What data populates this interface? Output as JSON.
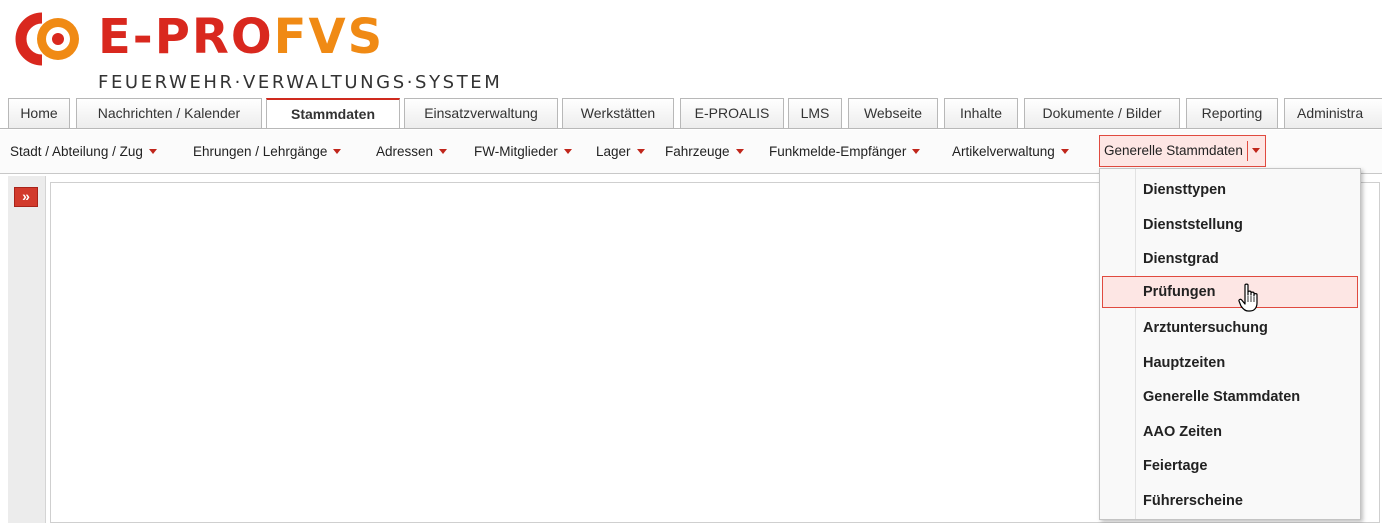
{
  "header": {
    "logo_prefix": "E-PRO",
    "logo_suffix": "FVS",
    "subtitle": "FEUERWEHR·VERWALTUNGS·SYSTEM"
  },
  "tabs": [
    {
      "label": "Home"
    },
    {
      "label": "Nachrichten / Kalender"
    },
    {
      "label": "Stammdaten",
      "active": true
    },
    {
      "label": "Einsatzverwaltung"
    },
    {
      "label": "Werkstätten"
    },
    {
      "label": "E-PROALIS"
    },
    {
      "label": "LMS"
    },
    {
      "label": "Webseite"
    },
    {
      "label": "Inhalte"
    },
    {
      "label": "Dokumente / Bilder"
    },
    {
      "label": "Reporting"
    },
    {
      "label": "Administra"
    }
  ],
  "subnav": [
    {
      "label": "Stadt / Abteilung / Zug"
    },
    {
      "label": "Ehrungen / Lehrgänge"
    },
    {
      "label": "Adressen"
    },
    {
      "label": "FW-Mitglieder"
    },
    {
      "label": "Lager"
    },
    {
      "label": "Fahrzeuge"
    },
    {
      "label": "Funkmelde-Empfänger"
    },
    {
      "label": "Artikelverwaltung"
    },
    {
      "label": "Generelle Stammdaten",
      "open": true
    }
  ],
  "left_panel": {
    "expand_glyph": "»"
  },
  "dropdown": {
    "items": [
      {
        "label": "Diensttypen"
      },
      {
        "label": "Dienststellung"
      },
      {
        "label": "Dienstgrad"
      },
      {
        "label": "Prüfungen",
        "hover": true
      },
      {
        "label": "Arztuntersuchung"
      },
      {
        "label": "Hauptzeiten"
      },
      {
        "label": "Generelle Stammdaten"
      },
      {
        "label": "AAO Zeiten"
      },
      {
        "label": "Feiertage"
      },
      {
        "label": "Führerscheine"
      }
    ]
  },
  "colors": {
    "brand_red": "#d9281e",
    "brand_orange": "#f08a14",
    "hover_bg": "#fde6e4",
    "hover_border": "#e04a3f"
  },
  "icons": {
    "logo": "e-pro-logo-icon",
    "expand": "double-chevron-right-icon",
    "caret": "caret-down-icon",
    "cursor": "hand-pointer-icon"
  }
}
